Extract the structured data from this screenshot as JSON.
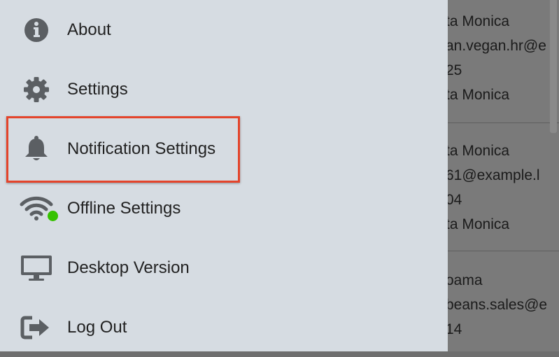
{
  "background_list": {
    "lines": [
      "ta Monica",
      "an.vegan.hr@e",
      "25",
      "ta Monica",
      "ta Monica",
      "61@example.l",
      "04",
      "ta Monica",
      "oama",
      "beans.sales@e",
      "14"
    ]
  },
  "menu": {
    "items": [
      {
        "label": "About",
        "icon": "info-circle-icon"
      },
      {
        "label": "Settings",
        "icon": "gear-icon"
      },
      {
        "label": "Notification Settings",
        "icon": "bell-icon"
      },
      {
        "label": "Offline Settings",
        "icon": "wifi-icon"
      },
      {
        "label": "Desktop Version",
        "icon": "monitor-icon"
      },
      {
        "label": "Log Out",
        "icon": "logout-icon"
      }
    ],
    "highlighted_item": "Notification Settings",
    "offline_status_color": "#36c200",
    "highlight_color": "#e4442b"
  }
}
